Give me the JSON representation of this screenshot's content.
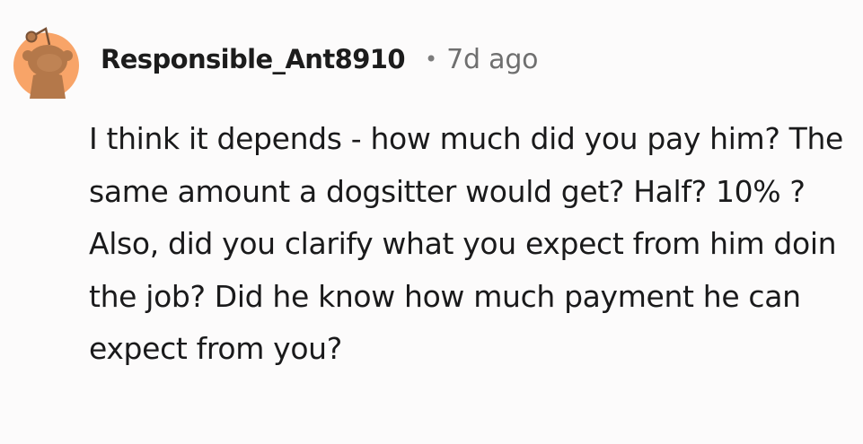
{
  "comment": {
    "avatar_icon": "reddit-snoo-avatar-icon",
    "username": "Responsible_Ant8910",
    "separator": "•",
    "timestamp": "7d ago",
    "body": "I think it depends - how much did you pay him? The same amount a dogsitter would get? Half? 10% ?Also, did you clarify what you expect from him doin the job? Did he know how much payment he can expect from you?"
  },
  "colors": {
    "background": "#fcfbfb",
    "avatar_bg": "#f8a468",
    "avatar_figure": "#b4784a",
    "text": "#1a1a1b",
    "meta": "#6f6f6f"
  }
}
